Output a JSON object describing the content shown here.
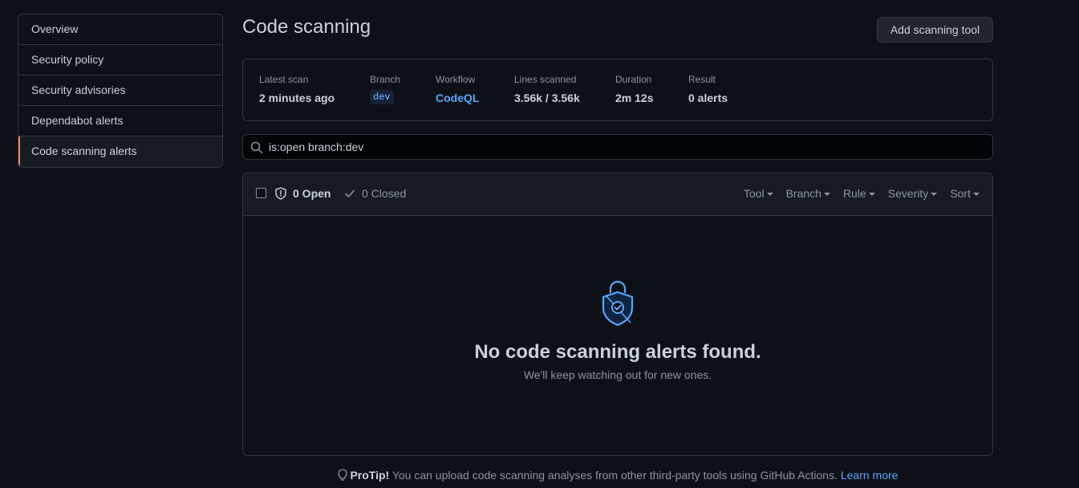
{
  "sidebar": {
    "items": [
      {
        "label": "Overview"
      },
      {
        "label": "Security policy"
      },
      {
        "label": "Security advisories"
      },
      {
        "label": "Dependabot alerts"
      },
      {
        "label": "Code scanning alerts"
      }
    ],
    "selected": "Code scanning alerts"
  },
  "header": {
    "title": "Code scanning",
    "add_tool_label": "Add scanning tool"
  },
  "scan_summary": {
    "latest_scan_label": "Latest scan",
    "latest_scan_value": "2 minutes ago",
    "branch_label": "Branch",
    "branch_value": "dev",
    "workflow_label": "Workflow",
    "workflow_value": "CodeQL",
    "lines_label": "Lines scanned",
    "lines_value": "3.56k / 3.56k",
    "duration_label": "Duration",
    "duration_value": "2m 12s",
    "result_label": "Result",
    "result_value": "0 alerts"
  },
  "search": {
    "value": "is:open branch:dev"
  },
  "results": {
    "open_label": "0 Open",
    "closed_label": "0 Closed",
    "filters": [
      "Tool",
      "Branch",
      "Rule",
      "Severity",
      "Sort"
    ],
    "empty_title": "No code scanning alerts found.",
    "empty_subtitle": "We'll keep watching out for new ones."
  },
  "protip": {
    "label": "ProTip!",
    "text": " You can upload code scanning analyses from other third-party tools using GitHub Actions. ",
    "link": "Learn more"
  },
  "colors": {
    "background": "#0d1117",
    "border": "#30363d",
    "link": "#58a6ff",
    "selected_accent": "#f78166"
  }
}
